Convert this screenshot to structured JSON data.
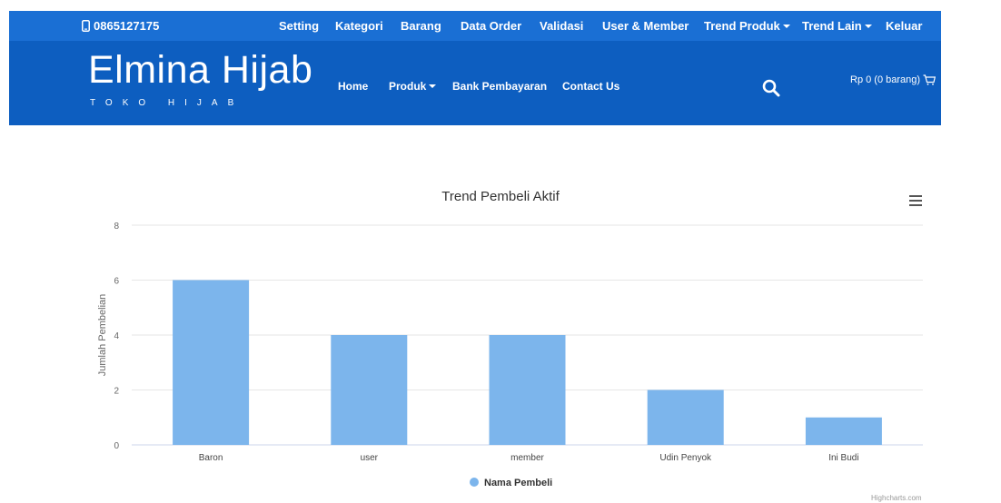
{
  "topbar": {
    "phone": "0865127175",
    "menu": [
      {
        "label": "Setting",
        "dropdown": false
      },
      {
        "label": "Kategori",
        "dropdown": false
      },
      {
        "label": "Barang",
        "dropdown": false
      },
      {
        "label": "Data Order",
        "dropdown": false
      },
      {
        "label": "Validasi",
        "dropdown": false
      },
      {
        "label": "User & Member",
        "dropdown": false
      },
      {
        "label": "Trend Produk",
        "dropdown": true
      },
      {
        "label": "Trend Lain",
        "dropdown": true
      },
      {
        "label": "Keluar",
        "dropdown": false
      }
    ]
  },
  "header": {
    "brand": "Elmina Hijab",
    "brand_sub": "TOKO HIJAB",
    "nav": [
      {
        "label": "Home",
        "dropdown": false
      },
      {
        "label": "Produk",
        "dropdown": true
      },
      {
        "label": "Bank Pembayaran",
        "dropdown": false
      },
      {
        "label": "Contact Us",
        "dropdown": false
      }
    ],
    "cart": "Rp 0 (0 barang)"
  },
  "colors": {
    "topbar": "#1a6fd4",
    "mainbar": "#0d5ec0",
    "bar": "#7cb5ec"
  },
  "chart_data": {
    "type": "bar",
    "title": "Trend Pembeli Aktif",
    "ylabel": "Jumlah Pembelian",
    "xlabel": "",
    "categories": [
      "Baron",
      "user",
      "member",
      "Udin Penyok",
      "Ini Budi"
    ],
    "series": [
      {
        "name": "Nama Pembeli",
        "values": [
          6,
          4,
          4,
          2,
          1
        ]
      }
    ],
    "ylim": [
      0,
      8
    ],
    "yticks": [
      0,
      2,
      4,
      6,
      8
    ],
    "grid": true,
    "legend": "bottom-center",
    "credit": "Highcharts.com"
  }
}
